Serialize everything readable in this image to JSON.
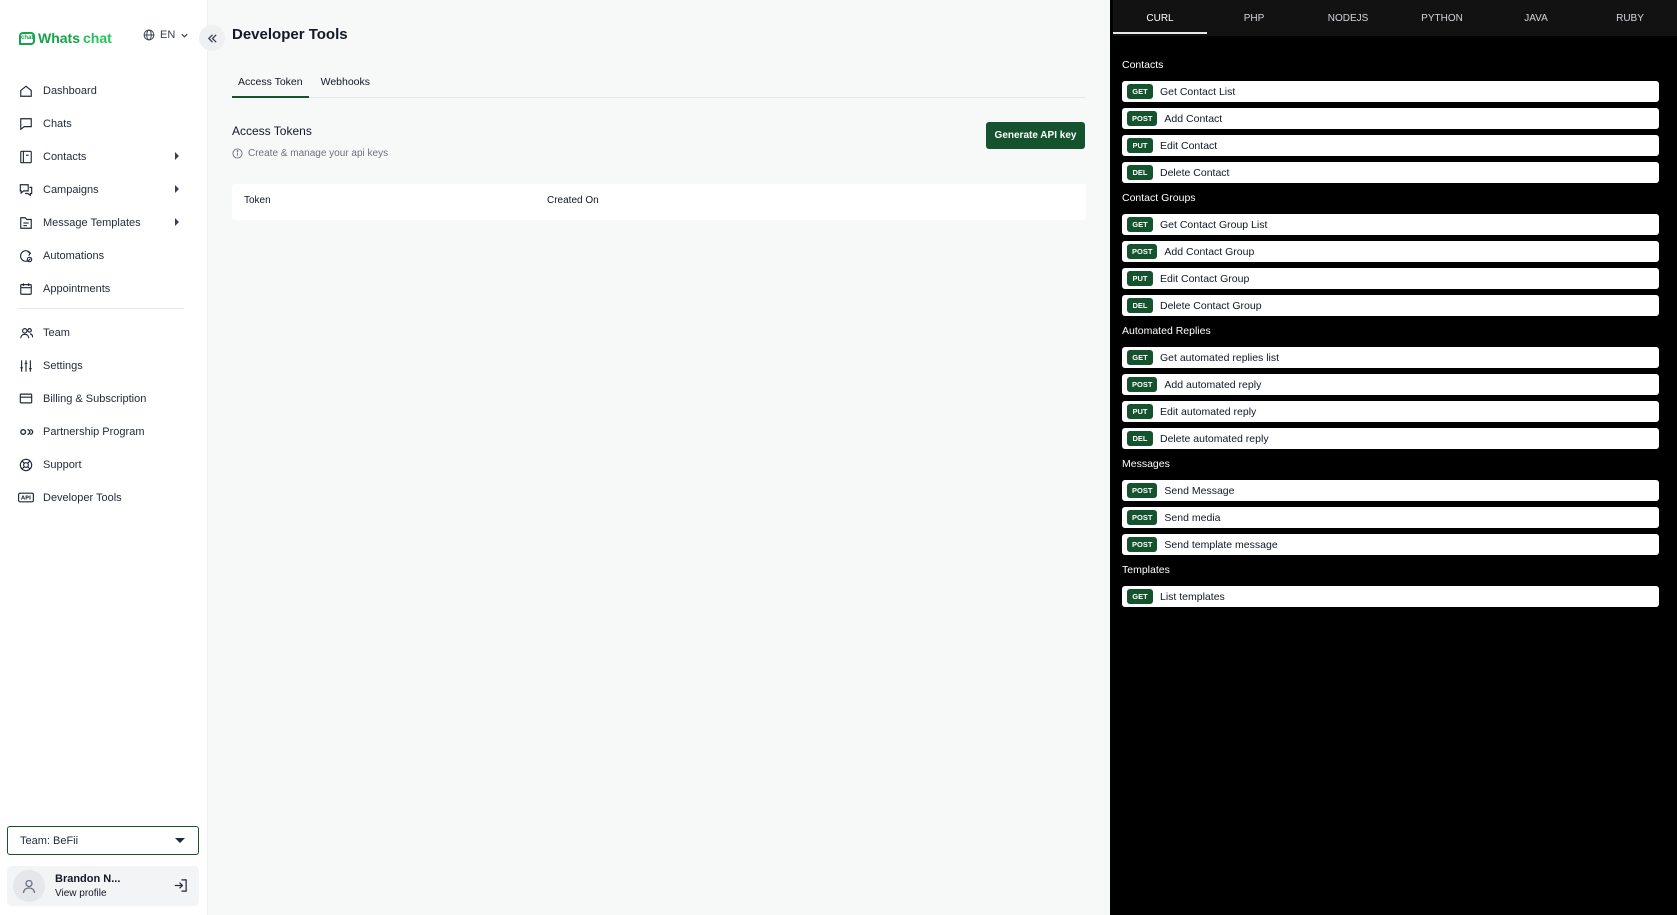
{
  "brand": {
    "name_a": "Whats",
    "name_b": "chat",
    "mark": "chat"
  },
  "language": {
    "current": "EN"
  },
  "sidebar": {
    "items": [
      {
        "label": "Dashboard",
        "icon": "home-icon",
        "has_submenu": false
      },
      {
        "label": "Chats",
        "icon": "chat-bubble-icon",
        "has_submenu": false
      },
      {
        "label": "Contacts",
        "icon": "contacts-book-icon",
        "has_submenu": true
      },
      {
        "label": "Campaigns",
        "icon": "campaign-chat-icon",
        "has_submenu": true
      },
      {
        "label": "Message Templates",
        "icon": "template-doc-icon",
        "has_submenu": true
      },
      {
        "label": "Automations",
        "icon": "automation-icon",
        "has_submenu": false
      },
      {
        "label": "Appointments",
        "icon": "calendar-icon",
        "has_submenu": false
      }
    ],
    "items_lower": [
      {
        "label": "Team",
        "icon": "team-icon"
      },
      {
        "label": "Settings",
        "icon": "sliders-icon"
      },
      {
        "label": "Billing & Subscription",
        "icon": "credit-card-icon"
      },
      {
        "label": "Partnership Program",
        "icon": "partnership-icon"
      },
      {
        "label": "Support",
        "icon": "lifebuoy-icon"
      },
      {
        "label": "Developer Tools",
        "icon": "api-icon"
      }
    ],
    "team_select": "Team: BeFii",
    "profile": {
      "name": "Brandon N...",
      "link": "View profile"
    }
  },
  "main": {
    "title": "Developer Tools",
    "tabs": [
      {
        "label": "Access Token",
        "active": true
      },
      {
        "label": "Webhooks",
        "active": false
      }
    ],
    "section_title": "Access Tokens",
    "section_subtitle": "Create & manage your api keys",
    "generate_button": "Generate API key",
    "table_headers": [
      "Token",
      "Created On"
    ]
  },
  "panel": {
    "lang_tabs": [
      "CURL",
      "PHP",
      "NODEJS",
      "PYTHON",
      "JAVA",
      "RUBY"
    ],
    "active_lang": "CURL",
    "groups": [
      {
        "title": "Contacts",
        "endpoints": [
          {
            "method": "GET",
            "label": "Get Contact List"
          },
          {
            "method": "POST",
            "label": "Add Contact"
          },
          {
            "method": "PUT",
            "label": "Edit Contact"
          },
          {
            "method": "DEL",
            "label": "Delete Contact"
          }
        ]
      },
      {
        "title": "Contact Groups",
        "endpoints": [
          {
            "method": "GET",
            "label": "Get Contact Group List"
          },
          {
            "method": "POST",
            "label": "Add Contact Group"
          },
          {
            "method": "PUT",
            "label": "Edit Contact Group"
          },
          {
            "method": "DEL",
            "label": "Delete Contact Group"
          }
        ]
      },
      {
        "title": "Automated Replies",
        "endpoints": [
          {
            "method": "GET",
            "label": "Get automated replies list"
          },
          {
            "method": "POST",
            "label": "Add automated reply"
          },
          {
            "method": "PUT",
            "label": "Edit automated reply"
          },
          {
            "method": "DEL",
            "label": "Delete automated reply"
          }
        ]
      },
      {
        "title": "Messages",
        "endpoints": [
          {
            "method": "POST",
            "label": "Send Message"
          },
          {
            "method": "POST",
            "label": "Send media"
          },
          {
            "method": "POST",
            "label": "Send template message"
          }
        ]
      },
      {
        "title": "Templates",
        "endpoints": [
          {
            "method": "GET",
            "label": "List templates"
          }
        ]
      }
    ]
  },
  "colors": {
    "brand_green": "#16a34a",
    "dark_green": "#14532d",
    "panel_bg": "#000000"
  }
}
